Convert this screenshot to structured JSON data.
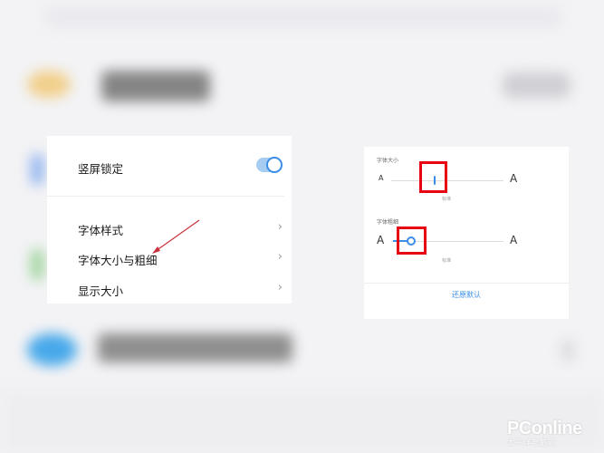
{
  "settings_panel": {
    "orientation_lock_label": "竖屏锁定",
    "orientation_lock_on": true,
    "font_style_label": "字体样式",
    "font_size_weight_label": "字体大小与粗细",
    "display_size_label": "显示大小",
    "chevron": "›"
  },
  "font_panel": {
    "size_label": "字体大小",
    "size_small_glyph": "A",
    "size_large_glyph": "A",
    "size_tick_label": "标准",
    "weight_label": "字体粗细",
    "weight_small_glyph": "A",
    "weight_large_glyph": "A",
    "weight_tick_label": "标准",
    "reset_label": "还原默认",
    "accent_color": "#3a8de6"
  },
  "annotations": {
    "highlight_color": "#e60012",
    "arrow_color": "#c8323c"
  },
  "watermark": {
    "logo": "PConline",
    "subtitle": "太平洋电脑网"
  }
}
